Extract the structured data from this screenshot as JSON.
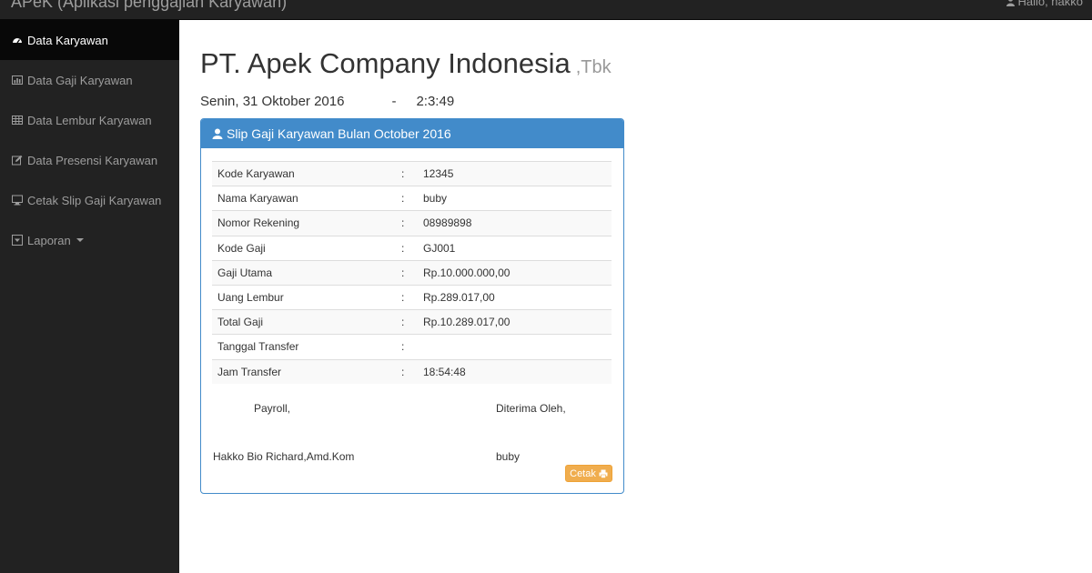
{
  "app": {
    "brand": "APeK (Aplikasi penggajian Karyawan)",
    "user_greeting": "Hallo, hakko"
  },
  "sidebar": {
    "items": [
      {
        "label": "Data Karyawan",
        "icon": "dashboard-icon",
        "active": true
      },
      {
        "label": "Data Gaji Karyawan",
        "icon": "bar-chart-icon"
      },
      {
        "label": "Data Lembur Karyawan",
        "icon": "table-icon"
      },
      {
        "label": "Data Presensi Karyawan",
        "icon": "edit-icon"
      },
      {
        "label": "Cetak Slip Gaji Karyawan",
        "icon": "desktop-icon"
      },
      {
        "label": "Laporan",
        "icon": "caret-square-down-icon",
        "has_dropdown": true
      }
    ]
  },
  "header": {
    "company": "PT. Apek Company Indonesia",
    "company_suffix": ",Tbk",
    "date": "Senin, 31 Oktober 2016",
    "separator": "-",
    "time": "2:3:49"
  },
  "slip": {
    "title": "Slip Gaji Karyawan Bulan October 2016",
    "rows": [
      {
        "label": "Kode Karyawan",
        "sep": ":",
        "value": "12345"
      },
      {
        "label": "Nama Karyawan",
        "sep": ":",
        "value": "buby"
      },
      {
        "label": "Nomor Rekening",
        "sep": ":",
        "value": "08989898"
      },
      {
        "label": "Kode Gaji",
        "sep": ":",
        "value": "GJ001"
      },
      {
        "label": "Gaji Utama",
        "sep": ":",
        "value": "Rp.10.000.000,00"
      },
      {
        "label": "Uang Lembur",
        "sep": ":",
        "value": "Rp.289.017,00"
      },
      {
        "label": "Total Gaji",
        "sep": ":",
        "value": "Rp.10.289.017,00"
      },
      {
        "label": "Tanggal Transfer",
        "sep": ":",
        "value": ""
      },
      {
        "label": "Jam Transfer",
        "sep": ":",
        "value": "18:54:48"
      }
    ],
    "payroll_label": "Payroll,",
    "receiver_label": "Diterima Oleh,",
    "payroll_name": "Hakko Bio Richard,Amd.Kom",
    "receiver_name": "buby",
    "print_label": "Cetak"
  },
  "colors": {
    "navbar": "#222222",
    "sidebar_active": "#080808",
    "panel_primary": "#428bca",
    "button_warning": "#f0ad4e"
  }
}
